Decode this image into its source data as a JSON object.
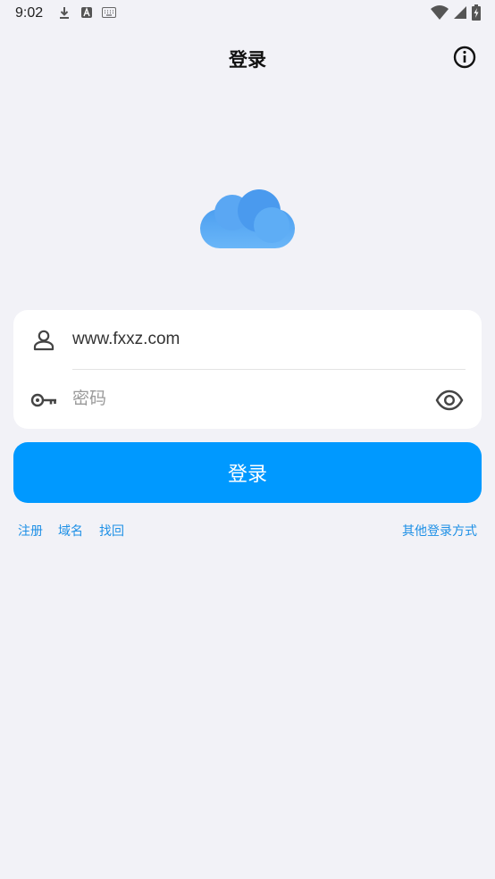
{
  "status_bar": {
    "time": "9:02",
    "left_icons": [
      "download-icon",
      "font-a-icon",
      "keyboard-icon"
    ],
    "right_icons": [
      "wifi-icon",
      "signal-icon",
      "battery-charging-icon"
    ]
  },
  "header": {
    "title": "登录",
    "info_icon": "info-circle-icon"
  },
  "logo_icon": "cloud-icon",
  "form": {
    "username_value": "www.fxxz.com",
    "username_icon": "user-icon",
    "password_placeholder": "密码",
    "password_icon": "key-icon",
    "toggle_icon": "eye-icon"
  },
  "login_button": "登录",
  "links": {
    "register": "注册",
    "domain": "域名",
    "recover": "找回",
    "other_login": "其他登录方式"
  },
  "colors": {
    "background": "#f2f2f7",
    "accent": "#0099ff",
    "link": "#1e90e6",
    "cloud": "#5aa9f5"
  }
}
